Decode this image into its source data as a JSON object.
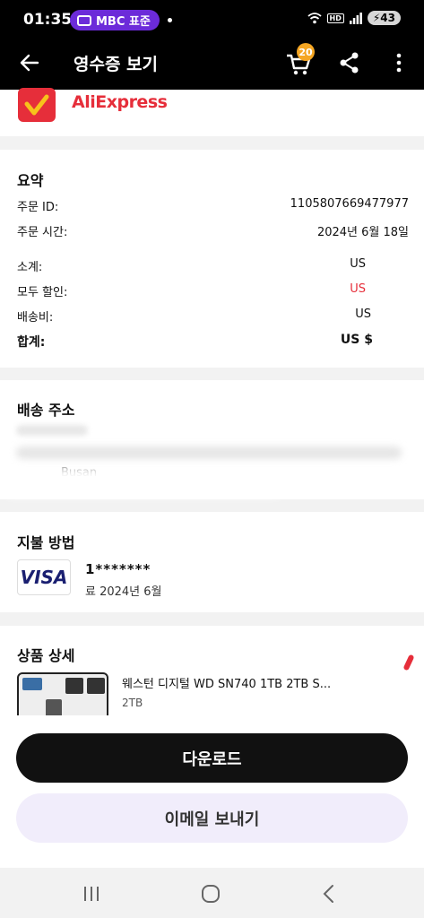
{
  "status_bar": {
    "time": "01:35",
    "radio_label": "MBC 표준",
    "network_badge": "HD",
    "battery": "43"
  },
  "app_bar": {
    "title": "영수증 보기",
    "cart_count": "20"
  },
  "brand": {
    "name": "AliExpress",
    "color": "#e62e3a"
  },
  "summary": {
    "title": "요약",
    "rows": [
      {
        "label": "주문 ID:",
        "value": "1105807669477977"
      },
      {
        "label": "주문 시간:",
        "value": "2024년 6월 18일"
      },
      {
        "label": "소계:",
        "value": "US"
      },
      {
        "label": "모두 할인:",
        "value": "US"
      },
      {
        "label": "배송비:",
        "value": "US"
      },
      {
        "label": "합계:",
        "value": "US $"
      }
    ]
  },
  "shipping": {
    "title": "배송 주소",
    "partial_city": "Busan"
  },
  "payment": {
    "title": "지불 방법",
    "card_brand": "VISA",
    "card_number": "1*******",
    "date_text": "료 2024년 6월"
  },
  "products": {
    "title": "상품 상세",
    "items": [
      {
        "name": "웨스턴 디지털 WD SN740 1TB 2TB S...",
        "option": "2TB"
      }
    ]
  },
  "actions": {
    "download": "다운로드",
    "email": "이메일 보내기"
  }
}
